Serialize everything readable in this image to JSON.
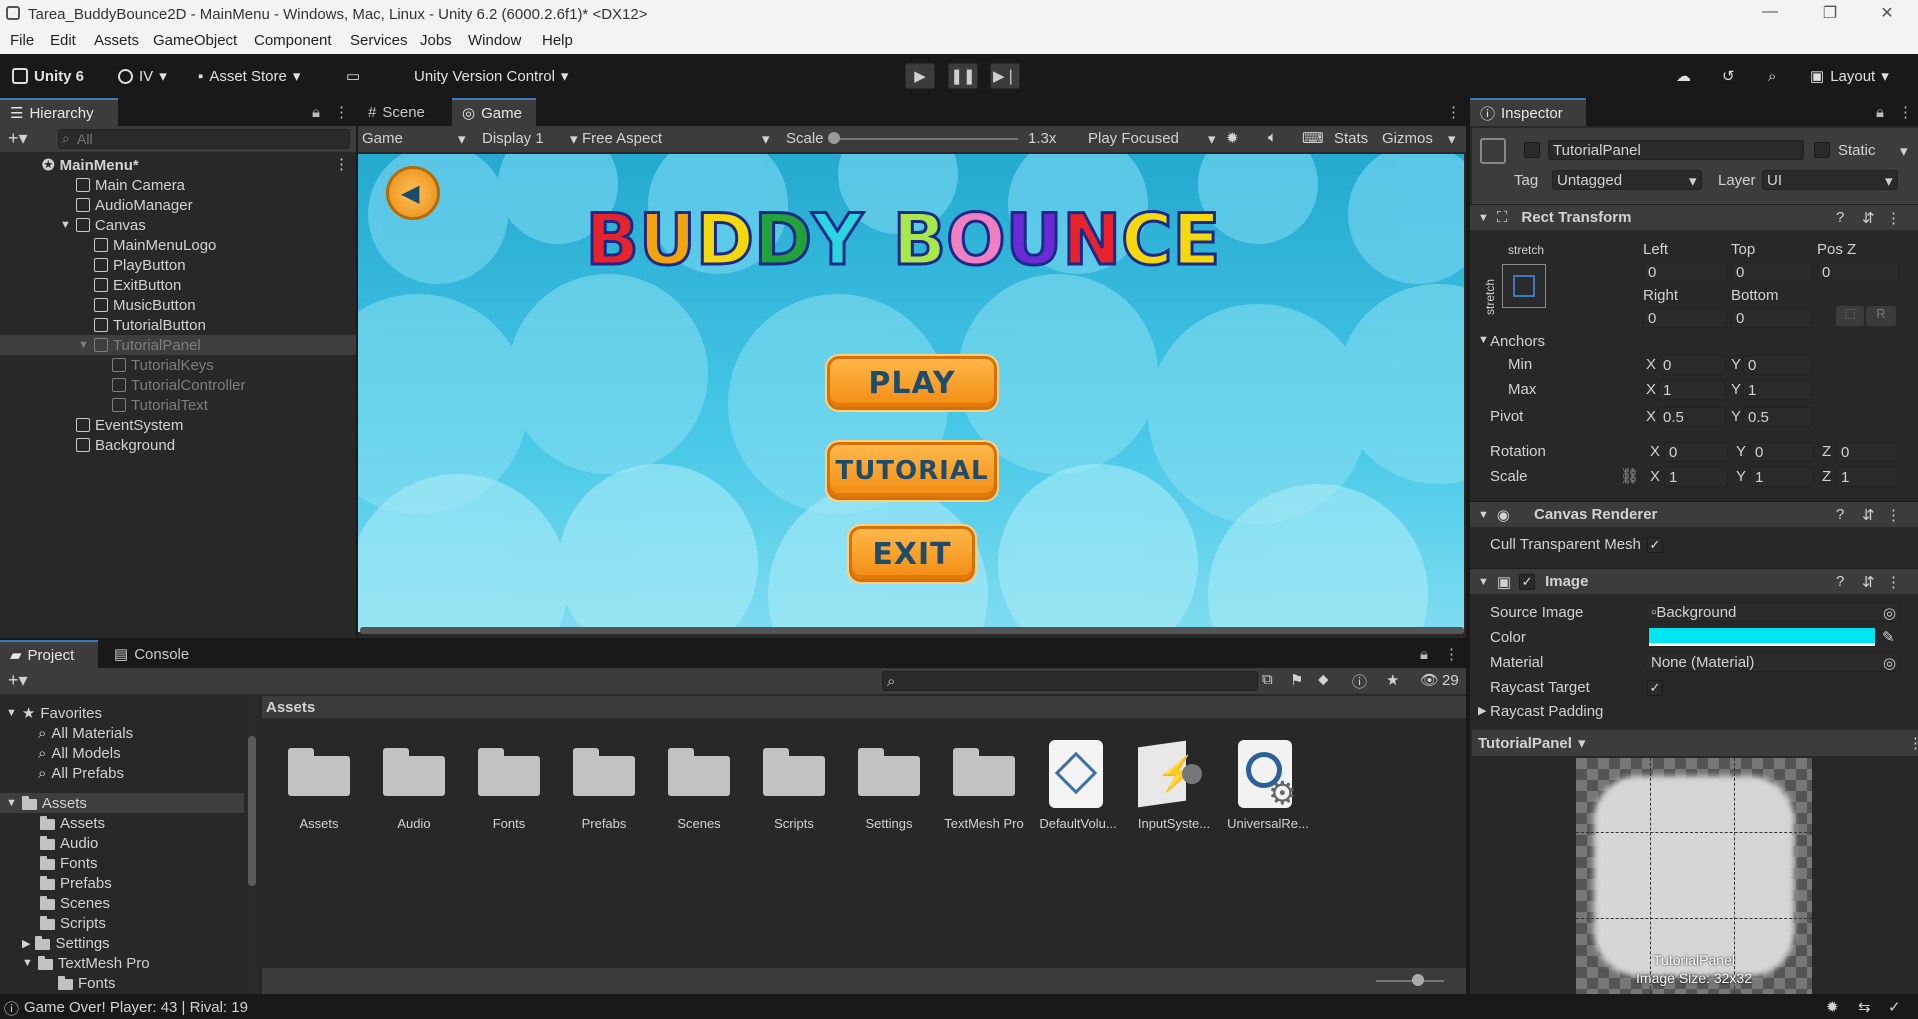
{
  "window": {
    "title": "Tarea_BuddyBounce2D - MainMenu - Windows, Mac, Linux - Unity 6.2 (6000.2.6f1)* <DX12>"
  },
  "menu": [
    "File",
    "Edit",
    "Assets",
    "GameObject",
    "Component",
    "Services",
    "Jobs",
    "Window",
    "Help"
  ],
  "toolbar": {
    "unity": "Unity 6",
    "account": "IV",
    "asset_store": "Asset Store",
    "version_control": "Unity Version Control",
    "layout": "Layout"
  },
  "hierarchy": {
    "tab": "Hierarchy",
    "search_placeholder": "All",
    "scene": "MainMenu*",
    "items": [
      "Main Camera",
      "AudioManager",
      "Canvas",
      "MainMenuLogo",
      "PlayButton",
      "ExitButton",
      "MusicButton",
      "TutorialButton",
      "TutorialPanel",
      "TutorialKeys",
      "TutorialController",
      "TutorialText",
      "EventSystem",
      "Background"
    ]
  },
  "scene_tabs": {
    "scene": "Scene",
    "game": "Game"
  },
  "game_toolbar": {
    "mode": "Game",
    "display": "Display 1",
    "aspect": "Free Aspect",
    "scale_label": "Scale",
    "scale_value": "1.3x",
    "scale_fraction": 0.0,
    "play_mode": "Play Focused",
    "stats": "Stats",
    "gizmos": "Gizmos"
  },
  "game_view": {
    "logo": "BUDDY BOUNCE",
    "play": "PLAY",
    "tutorial": "TUTORIAL",
    "exit": "EXIT",
    "colors": {
      "sky": "#2fb7d6",
      "button": "#f7a023",
      "button_text": "#1e4d6b"
    },
    "logo_colors": [
      "#e8232b",
      "#f5a20f",
      "#f5d90f",
      "#23a13a",
      "#2ad6e0",
      "#a8e84a",
      "#f07fc2",
      "#6a2bd6",
      "#e8232b",
      "#f5d90f",
      "#f5d90f"
    ]
  },
  "inspector": {
    "tab": "Inspector",
    "object_name": "TutorialPanel",
    "static": "Static",
    "tag_label": "Tag",
    "tag": "Untagged",
    "layer_label": "Layer",
    "layer": "UI",
    "rect_transform": {
      "title": "Rect Transform",
      "stretch": "stretch",
      "left_label": "Left",
      "top_label": "Top",
      "posz_label": "Pos Z",
      "left": "0",
      "top": "0",
      "posz": "0",
      "right_label": "Right",
      "bottom_label": "Bottom",
      "right": "0",
      "bottom": "0",
      "anchors": "Anchors",
      "min": "Min",
      "max": "Max",
      "min_x": "0",
      "min_y": "0",
      "max_x": "1",
      "max_y": "1",
      "pivot": "Pivot",
      "pivot_x": "0.5",
      "pivot_y": "0.5",
      "rotation": "Rotation",
      "rot_x": "0",
      "rot_y": "0",
      "rot_z": "0",
      "scale": "Scale",
      "scale_x": "1",
      "scale_y": "1",
      "scale_z": "1",
      "x": "X",
      "y": "Y",
      "z": "Z",
      "r": "R"
    },
    "canvas_renderer": {
      "title": "Canvas Renderer",
      "cull": "Cull Transparent Mesh"
    },
    "image": {
      "title": "Image",
      "source_label": "Source Image",
      "source": "Background",
      "color_label": "Color",
      "color": "#00e5f0",
      "material_label": "Material",
      "material": "None (Material)",
      "raycast_target": "Raycast Target",
      "raycast_padding": "Raycast Padding"
    },
    "preview": {
      "title": "TutorialPanel",
      "name": "TutorialPanel",
      "size": "Image Size: 32x32"
    }
  },
  "project": {
    "tab": "Project",
    "console_tab": "Console",
    "count": "29",
    "breadcrumb": "Assets",
    "tree": {
      "favorites": "Favorites",
      "fav_items": [
        "All Materials",
        "All Models",
        "All Prefabs"
      ],
      "assets": "Assets",
      "asset_items": [
        "Assets",
        "Audio",
        "Fonts",
        "Prefabs",
        "Scenes",
        "Scripts",
        "Settings",
        "TextMesh Pro"
      ],
      "tmp_child": "Fonts"
    },
    "folders": [
      "Assets",
      "Audio",
      "Fonts",
      "Prefabs",
      "Scenes",
      "Scripts",
      "Settings",
      "TextMesh Pro"
    ],
    "files": [
      "DefaultVolu...",
      "InputSyste...",
      "UniversalRe..."
    ]
  },
  "status": {
    "message": "Game Over! Player: 43 | Rival: 19"
  }
}
